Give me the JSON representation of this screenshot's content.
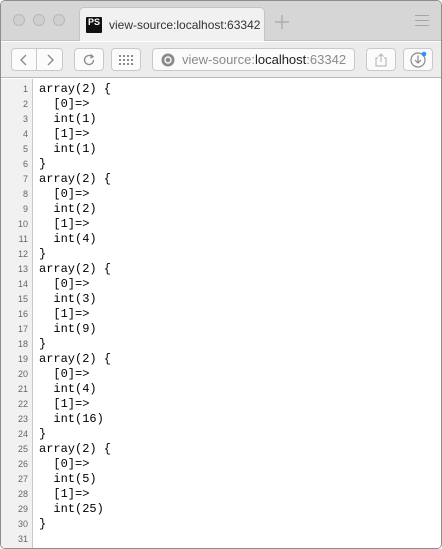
{
  "tab": {
    "title": "view-source:localhost:63342",
    "icon": "phpstorm-icon",
    "icon_text": "PS"
  },
  "address": {
    "scheme": "view-source:",
    "host": "localhost",
    "rest": ":63342"
  },
  "source_lines": [
    "array(2) {",
    "  [0]=>",
    "  int(1)",
    "  [1]=>",
    "  int(1)",
    "}",
    "array(2) {",
    "  [0]=>",
    "  int(2)",
    "  [1]=>",
    "  int(4)",
    "}",
    "array(2) {",
    "  [0]=>",
    "  int(3)",
    "  [1]=>",
    "  int(9)",
    "}",
    "array(2) {",
    "  [0]=>",
    "  int(4)",
    "  [1]=>",
    "  int(16)",
    "}",
    "array(2) {",
    "  [0]=>",
    "  int(5)",
    "  [1]=>",
    "  int(25)",
    "}",
    ""
  ],
  "line_numbers": [
    "1",
    "2",
    "3",
    "4",
    "5",
    "6",
    "7",
    "8",
    "9",
    "10",
    "11",
    "12",
    "13",
    "14",
    "15",
    "16",
    "17",
    "18",
    "19",
    "20",
    "21",
    "22",
    "23",
    "24",
    "25",
    "26",
    "27",
    "28",
    "29",
    "30",
    "31"
  ],
  "colors": {
    "titlebar": "#d6d6d6",
    "toolbar": "#ececec",
    "gutter": "#f1f1f1",
    "download_dot": "#2f8fff"
  }
}
